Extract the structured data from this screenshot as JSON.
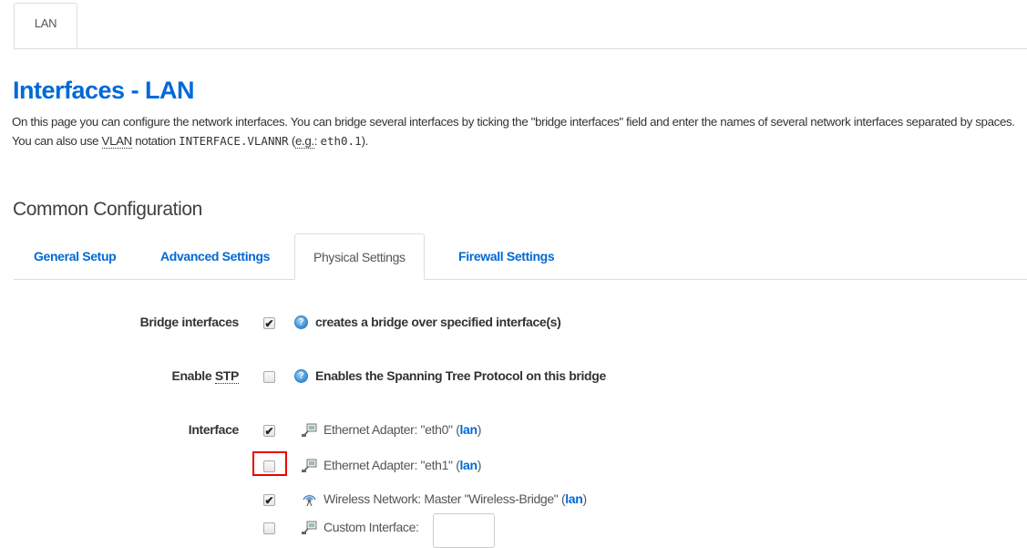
{
  "top_tabs": [
    {
      "label": "LAN"
    }
  ],
  "page_title": "Interfaces - LAN",
  "description": {
    "part1": "On this page you can configure the network interfaces. You can bridge several interfaces by ticking the \"bridge interfaces\" field and enter the names of several network interfaces separated by spaces. You can also use ",
    "vlan": "VLAN",
    "part2": " notation ",
    "code1": "INTERFACE.VLANNR",
    "part3": " (",
    "eg": "e.g.",
    "part4": ": ",
    "code2": "eth0.1",
    "part5": ")."
  },
  "section_title": "Common Configuration",
  "sub_tabs": [
    "General Setup",
    "Advanced Settings",
    "Physical Settings",
    "Firewall Settings"
  ],
  "active_sub_tab": "Physical Settings",
  "bridge": {
    "label": "Bridge interfaces",
    "checked": true,
    "help": "creates a bridge over specified interface(s)"
  },
  "stp": {
    "label_prefix": "Enable ",
    "label_abbr": "STP",
    "checked": false,
    "help": "Enables the Spanning Tree Protocol on this bridge"
  },
  "interface_label": "Interface",
  "interfaces": [
    {
      "checked": true,
      "icon": "ethernet-icon",
      "text": "Ethernet Adapter: \"eth0\" ",
      "link": "lan"
    },
    {
      "checked": false,
      "icon": "ethernet-icon",
      "text": "Ethernet Adapter: \"eth1\" ",
      "link": "lan"
    },
    {
      "checked": true,
      "icon": "wireless-icon",
      "text": "Wireless Network: Master \"Wireless-Bridge\" ",
      "link": "lan"
    },
    {
      "checked": false,
      "icon": "ethernet-icon",
      "text": "Custom Interface:",
      "link": ""
    }
  ],
  "colors": {
    "accent": "#0069d6",
    "highlight": "#e00000"
  }
}
